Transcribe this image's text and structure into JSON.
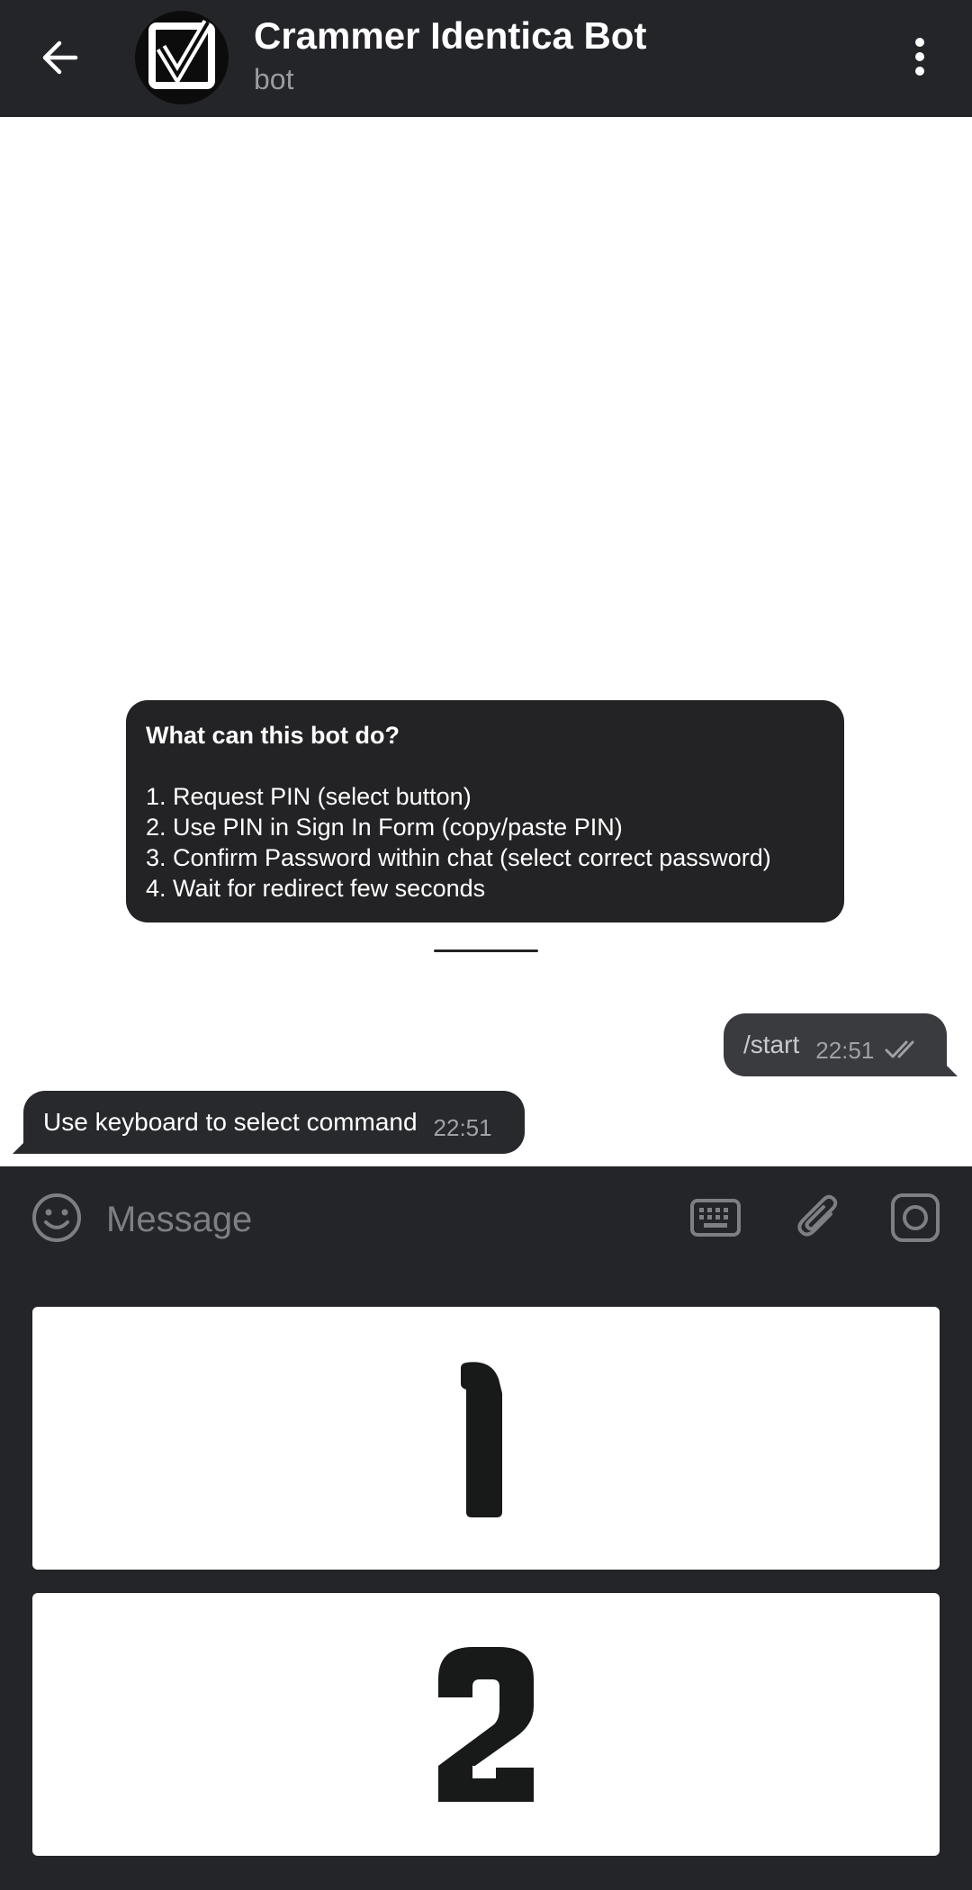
{
  "header": {
    "title": "Crammer Identica Bot",
    "subtitle": "bot"
  },
  "about": {
    "title": "What can this bot do?",
    "lines": [
      "1. Request PIN (select button)",
      "2. Use PIN in Sign In Form (copy/paste PIN)",
      "3. Confirm Password within chat (select correct password)",
      "4. Wait for redirect few seconds"
    ]
  },
  "messages": [
    {
      "direction": "outgoing",
      "text": "/start",
      "time": "22:51",
      "status": "read"
    },
    {
      "direction": "incoming",
      "text": "Use keyboard to select command",
      "time": "22:51"
    }
  ],
  "composer": {
    "placeholder": "Message",
    "value": ""
  },
  "keyboard": {
    "buttons": [
      {
        "label": "1"
      },
      {
        "label": "2"
      }
    ]
  },
  "colors": {
    "bar": "#242528",
    "bubble_out": "#3a3b3f",
    "bubble_in": "#28292c",
    "card": "#232325",
    "key": "#ffffff"
  },
  "icons": {
    "back": "arrow-left-icon",
    "menu": "more-vertical-icon",
    "avatar": "checkbox-check-icon",
    "emoji": "smiley-icon",
    "keyboard": "keyboard-icon",
    "attach": "paperclip-icon",
    "camera": "camera-icon",
    "read": "double-check-icon"
  }
}
